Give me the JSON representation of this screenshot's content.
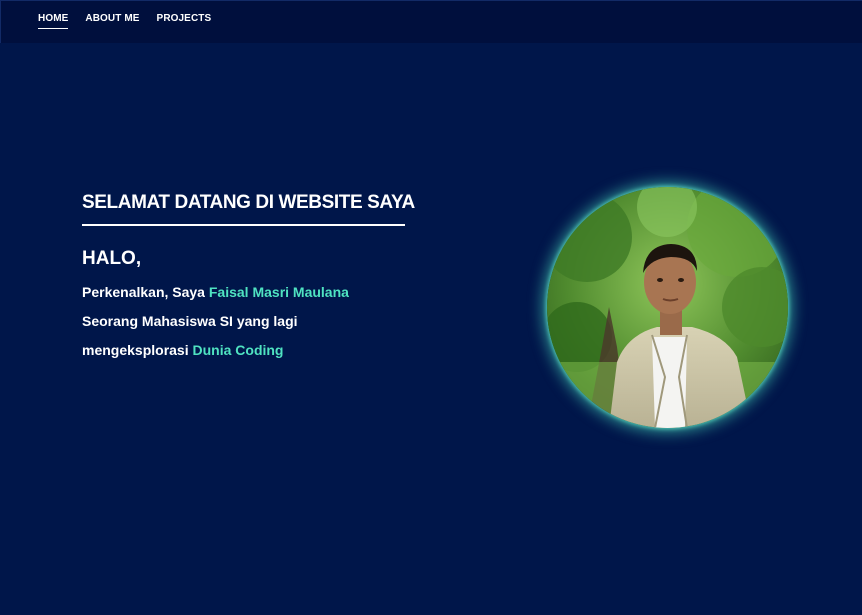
{
  "nav": {
    "items": [
      {
        "label": "HOME",
        "active": true
      },
      {
        "label": "ABOUT ME",
        "active": false
      },
      {
        "label": "PROJECTS",
        "active": false
      }
    ]
  },
  "hero": {
    "title": "SELAMAT DATANG DI WEBSITE SAYA",
    "greeting": "HALO,",
    "line1_prefix": "Perkenalkan, Saya ",
    "line1_name": "Faisal Masri Maulana",
    "line2": "Seorang Mahasiswa SI yang lagi",
    "line3_prefix": "mengeksplorasi ",
    "line3_highlight": "Dunia Coding"
  },
  "colors": {
    "background": "#00164a",
    "navbar": "#000f3d",
    "accent": "#4fe3c1",
    "text": "#ffffff"
  },
  "portrait": {
    "icon": "profile-photo"
  }
}
